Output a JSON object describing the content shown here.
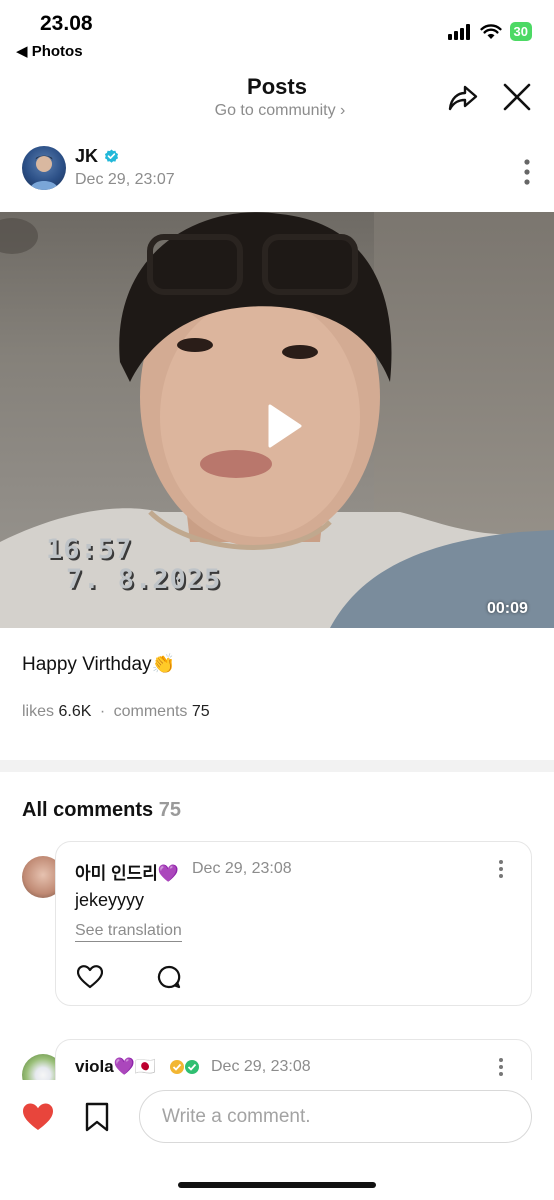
{
  "status_bar": {
    "time": "23.08",
    "back_label": "◀ Photos",
    "battery": "30"
  },
  "header": {
    "title": "Posts",
    "subtitle": "Go to community ›"
  },
  "post": {
    "author": "JK",
    "date": "Dec 29, 23:07",
    "video": {
      "timestamp_line1": "16:57",
      "timestamp_line2": "7. 8.2025",
      "duration": "00:09"
    },
    "caption": "Happy Virthday👏",
    "likes_label": "likes",
    "likes_count": "6.6K",
    "separator": "·",
    "comments_label": "comments",
    "comments_count": "75"
  },
  "comments": {
    "heading": "All comments",
    "count": "75",
    "items": [
      {
        "name": "아미 인드리💜",
        "date": "Dec 29, 23:08",
        "text": "jekeyyyy",
        "translate": "See translation"
      },
      {
        "name": "viola💜🇯🇵",
        "date": "Dec 29, 23:08"
      }
    ]
  },
  "bottom": {
    "input_placeholder": "Write a comment."
  },
  "colors": {
    "accent": "#e8453c",
    "verified": "#22b8d9",
    "muted": "#8c8c8c",
    "battery": "#4cd964"
  }
}
